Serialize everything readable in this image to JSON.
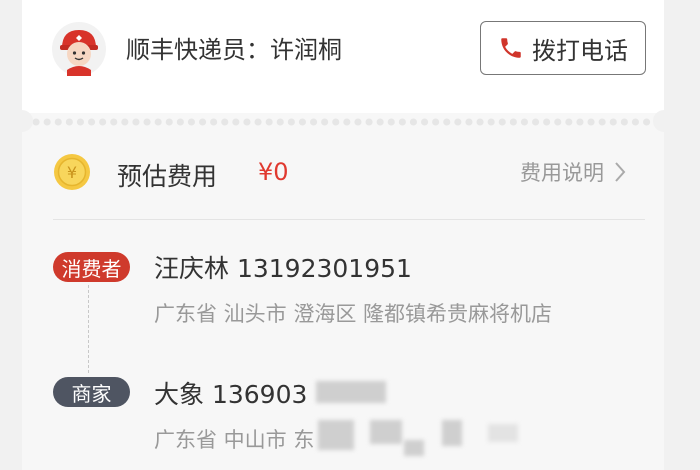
{
  "courier": {
    "label": "顺丰快递员：许润桐",
    "call_button": "拨打电话"
  },
  "fee": {
    "label": "预估费用",
    "value": "¥0",
    "link": "费用说明"
  },
  "consumer": {
    "badge": "消费者",
    "name_phone": "汪庆林 13192301951",
    "address": "广东省 汕头市 澄海区 隆都镇希贵麻将机店"
  },
  "merchant": {
    "badge": "商家",
    "name_phone": "大象 136903",
    "address": "广东省 中山市 东"
  },
  "colors": {
    "accent_red": "#cf3a2c",
    "price_red": "#e0392f",
    "merchant_badge": "#4f5562"
  },
  "icons": [
    "courier-avatar-icon",
    "phone-icon",
    "coin-yen-icon",
    "chevron-right-icon"
  ]
}
